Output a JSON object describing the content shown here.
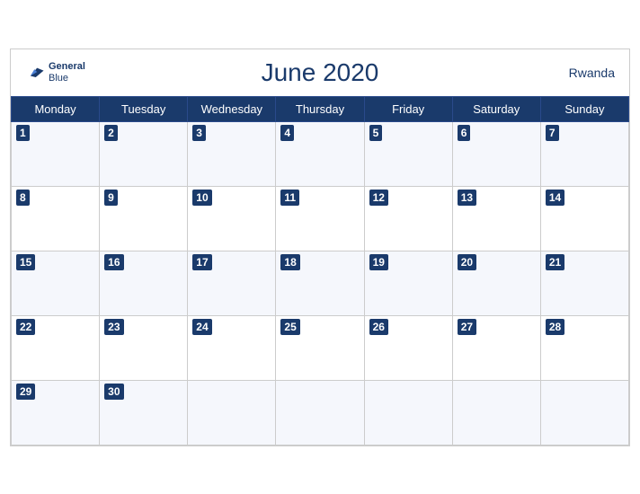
{
  "header": {
    "title": "June 2020",
    "country": "Rwanda",
    "logo_line1": "General",
    "logo_line2": "Blue"
  },
  "days_of_week": [
    "Monday",
    "Tuesday",
    "Wednesday",
    "Thursday",
    "Friday",
    "Saturday",
    "Sunday"
  ],
  "weeks": [
    [
      {
        "day": 1,
        "empty": false
      },
      {
        "day": 2,
        "empty": false
      },
      {
        "day": 3,
        "empty": false
      },
      {
        "day": 4,
        "empty": false
      },
      {
        "day": 5,
        "empty": false
      },
      {
        "day": 6,
        "empty": false
      },
      {
        "day": 7,
        "empty": false
      }
    ],
    [
      {
        "day": 8,
        "empty": false
      },
      {
        "day": 9,
        "empty": false
      },
      {
        "day": 10,
        "empty": false
      },
      {
        "day": 11,
        "empty": false
      },
      {
        "day": 12,
        "empty": false
      },
      {
        "day": 13,
        "empty": false
      },
      {
        "day": 14,
        "empty": false
      }
    ],
    [
      {
        "day": 15,
        "empty": false
      },
      {
        "day": 16,
        "empty": false
      },
      {
        "day": 17,
        "empty": false
      },
      {
        "day": 18,
        "empty": false
      },
      {
        "day": 19,
        "empty": false
      },
      {
        "day": 20,
        "empty": false
      },
      {
        "day": 21,
        "empty": false
      }
    ],
    [
      {
        "day": 22,
        "empty": false
      },
      {
        "day": 23,
        "empty": false
      },
      {
        "day": 24,
        "empty": false
      },
      {
        "day": 25,
        "empty": false
      },
      {
        "day": 26,
        "empty": false
      },
      {
        "day": 27,
        "empty": false
      },
      {
        "day": 28,
        "empty": false
      }
    ],
    [
      {
        "day": 29,
        "empty": false
      },
      {
        "day": 30,
        "empty": false
      },
      {
        "day": null,
        "empty": true
      },
      {
        "day": null,
        "empty": true
      },
      {
        "day": null,
        "empty": true
      },
      {
        "day": null,
        "empty": true
      },
      {
        "day": null,
        "empty": true
      }
    ]
  ]
}
